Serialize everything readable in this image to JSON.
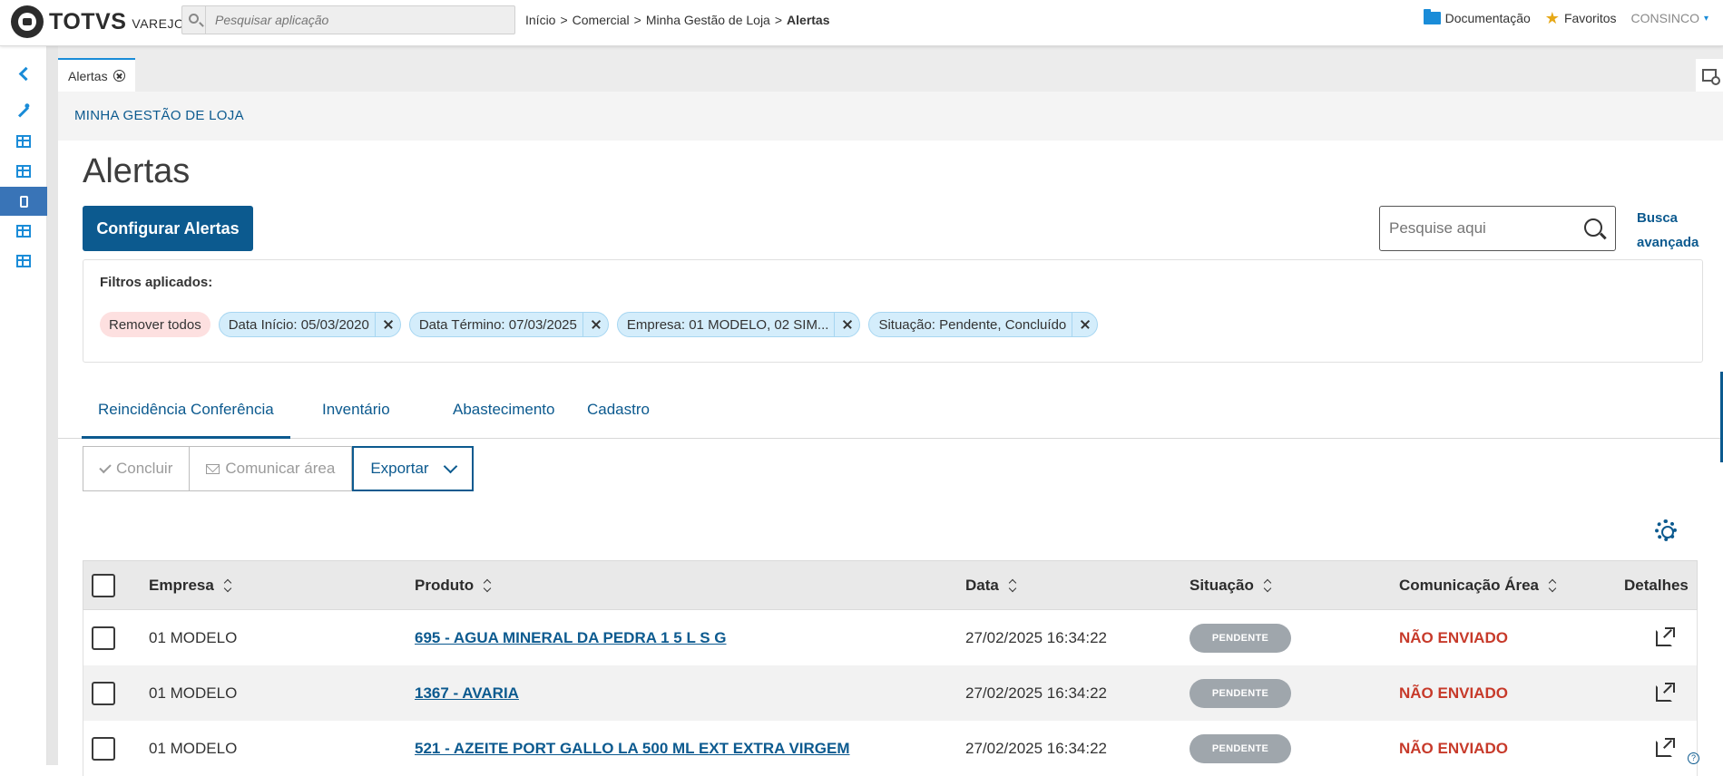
{
  "app": {
    "brand": "TOTVS",
    "product": "VAREJO"
  },
  "top_search": {
    "placeholder": "Pesquisar aplicação"
  },
  "breadcrumb": {
    "items": [
      "Início",
      ">",
      "Comercial",
      ">",
      "Minha Gestão de Loja",
      ">"
    ],
    "current": "Alertas"
  },
  "top_right": {
    "docs": "Documentação",
    "favorites": "Favoritos",
    "user": "CONSINCO",
    "caret": "▾"
  },
  "tabstrip": {
    "tab_label": "Alertas"
  },
  "section": {
    "header": "MINHA GESTÃO DE LOJA",
    "title": "Alertas"
  },
  "actions": {
    "configure_label": "Configurar Alertas"
  },
  "search": {
    "placeholder": "Pesquise aqui",
    "advanced_line1": "Busca",
    "advanced_line2": "avançada"
  },
  "filters": {
    "label": "Filtros aplicados:",
    "remove_all": "Remover todos",
    "chips": [
      "Data Início: 05/03/2020",
      "Data Término: 07/03/2025",
      "Empresa: 01 MODELO, 02 SIM...",
      "Situação: Pendente, Concluído"
    ]
  },
  "nav_tabs": [
    "Reincidência Conferência",
    "Inventário",
    "Abastecimento",
    "Cadastro"
  ],
  "toolbar": {
    "conclude": "Concluir",
    "notify": "Comunicar área",
    "export": "Exportar"
  },
  "table": {
    "headers": {
      "empresa": "Empresa",
      "produto": "Produto",
      "data": "Data",
      "situacao": "Situação",
      "comunicacao": "Comunicação Área",
      "detalhes": "Detalhes"
    },
    "rows": [
      {
        "empresa": "01 MODELO",
        "produto": "695 - AGUA MINERAL DA PEDRA 1 5 L S G",
        "data": "27/02/2025 16:34:22",
        "situacao": "PENDENTE",
        "comunicacao": "NÃO ENVIADO"
      },
      {
        "empresa": "01 MODELO",
        "produto": "1367 - AVARIA",
        "data": "27/02/2025 16:34:22",
        "situacao": "PENDENTE",
        "comunicacao": "NÃO ENVIADO"
      },
      {
        "empresa": "01 MODELO",
        "produto": "521 - AZEITE PORT GALLO LA 500 ML EXT EXTRA VIRGEM",
        "data": "27/02/2025 16:34:22",
        "situacao": "PENDENTE",
        "comunicacao": "NÃO ENVIADO"
      }
    ]
  },
  "help": "?",
  "colors": {
    "primary": "#0c5a8f",
    "accent": "#1a8cd8",
    "danger": "#c73a2a",
    "badge": "#9fa6ac"
  }
}
